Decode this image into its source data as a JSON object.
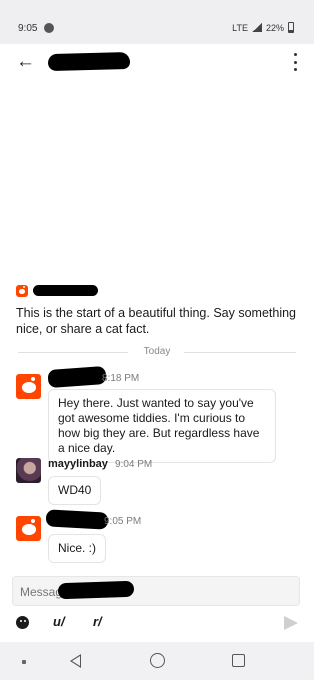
{
  "status": {
    "time": "9:05",
    "network": "LTE",
    "battery": "22%"
  },
  "chat": {
    "intro": "This is the start of a beautiful thing. Say something nice, or share a cat fact.",
    "divider": "Today",
    "messages": [
      {
        "time": "8:18 PM",
        "text": "Hey there. Just wanted to say you've got awesome tiddies. I'm curious to how big they are. But regardless have a nice day."
      },
      {
        "name": "mayylinbay",
        "time": "9:04 PM",
        "text": "WD40"
      },
      {
        "time": "9:05 PM",
        "text": "Nice. :)"
      }
    ]
  },
  "composer": {
    "placeholder": "Message"
  },
  "toolbar": {
    "user_label": "u/",
    "sub_label": "r/"
  }
}
